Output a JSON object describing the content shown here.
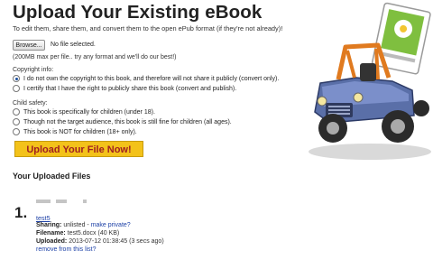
{
  "header": {
    "title": "Upload Your Existing eBook",
    "subtitle": "To edit them, share them, and convert them to the open ePub format (if they're not already)!"
  },
  "file_input": {
    "browse_label": "Browse...",
    "status": "No file selected.",
    "limit_note": "(200MB max per file.. try any format and we'll do our best!)"
  },
  "copyright": {
    "label": "Copyright info:",
    "options": [
      {
        "text": "I do not own the copyright to this book, and therefore will not share it publicly (convert only).",
        "selected": true
      },
      {
        "text": "I certify that I have the right to publicly share this book (convert and publish).",
        "selected": false
      }
    ]
  },
  "child_safety": {
    "label": "Child safety:",
    "options": [
      {
        "text": "This book is specifically for children (under 18).",
        "selected": false
      },
      {
        "text": "Though not the target audience, this book is still fine for children (all ages).",
        "selected": false
      },
      {
        "text": "This book is NOT for children (18+ only).",
        "selected": false
      }
    ]
  },
  "upload_button_label": "Upload Your File Now!",
  "uploaded": {
    "heading": "Your Uploaded Files",
    "items": [
      {
        "number": "1.",
        "title": "test5",
        "sharing_label": "Sharing:",
        "sharing_value": "unlisted - ",
        "make_private": "make private?",
        "filename_label": "Filename:",
        "filename_value": "test5.docx (40 KB)",
        "uploaded_label": "Uploaded:",
        "uploaded_value": "2013-07-12 01:38:45 (3 secs ago)",
        "remove_link": "remove from this list?"
      }
    ]
  },
  "colors": {
    "upload_button_bg": "#f3c21a",
    "upload_button_text": "#a02020",
    "link": "#1b3fa6"
  },
  "illustration": {
    "icon": "truck-carrying-ebook-icon"
  }
}
